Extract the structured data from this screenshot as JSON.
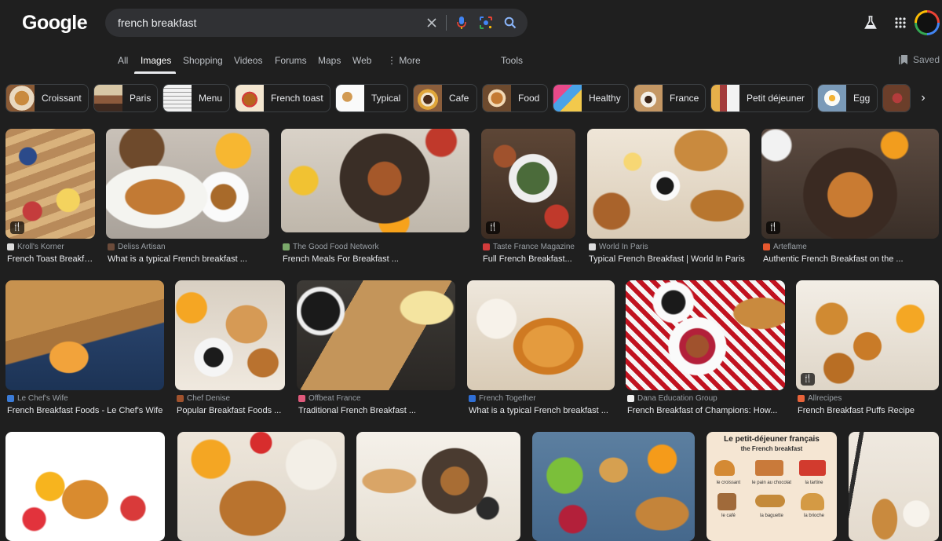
{
  "search": {
    "query": "french breakfast"
  },
  "logo": "Google",
  "nav": {
    "tabs": [
      "All",
      "Images",
      "Shopping",
      "Videos",
      "Forums",
      "Maps",
      "Web"
    ],
    "more": "More",
    "tools": "Tools",
    "saved": "Saved"
  },
  "chips": [
    "Croissant",
    "Paris",
    "Menu",
    "French toast",
    "Typical",
    "Cafe",
    "Food",
    "Healthy",
    "France",
    "Petit déjeuner",
    "Egg"
  ],
  "results": [
    {
      "source": "Kroll's Korner",
      "caption": "French Toast Breakfast..."
    },
    {
      "source": "Deliss Artisan",
      "caption": "What is a typical French breakfast ..."
    },
    {
      "source": "The Good Food Network",
      "caption": "French Meals For Breakfast ..."
    },
    {
      "source": "Taste France Magazine",
      "caption": "Full French Breakfast..."
    },
    {
      "source": "World In Paris",
      "caption": "Typical French Breakfast | World In Paris"
    },
    {
      "source": "Arteflame",
      "caption": "Authentic French Breakfast on the ..."
    },
    {
      "source": "Le Chef's Wife",
      "caption": "French Breakfast Foods - Le Chef's Wife"
    },
    {
      "source": "Chef Denise",
      "caption": "Popular Breakfast Foods ..."
    },
    {
      "source": "Offbeat France",
      "caption": "Traditional French Breakfast ..."
    },
    {
      "source": "French Together",
      "caption": "What is a typical French breakfast ..."
    },
    {
      "source": "Dana Education Group",
      "caption": "French Breakfast of Champions: How..."
    },
    {
      "source": "Allrecipes",
      "caption": "French Breakfast Puffs Recipe"
    }
  ],
  "poster": {
    "title": "Le petit-déjeuner français",
    "subtitle": "the French breakfast",
    "items": [
      "le croissant",
      "le pain au chocolat",
      "la tartine",
      "le café",
      "la baguette",
      "la brioche"
    ]
  }
}
